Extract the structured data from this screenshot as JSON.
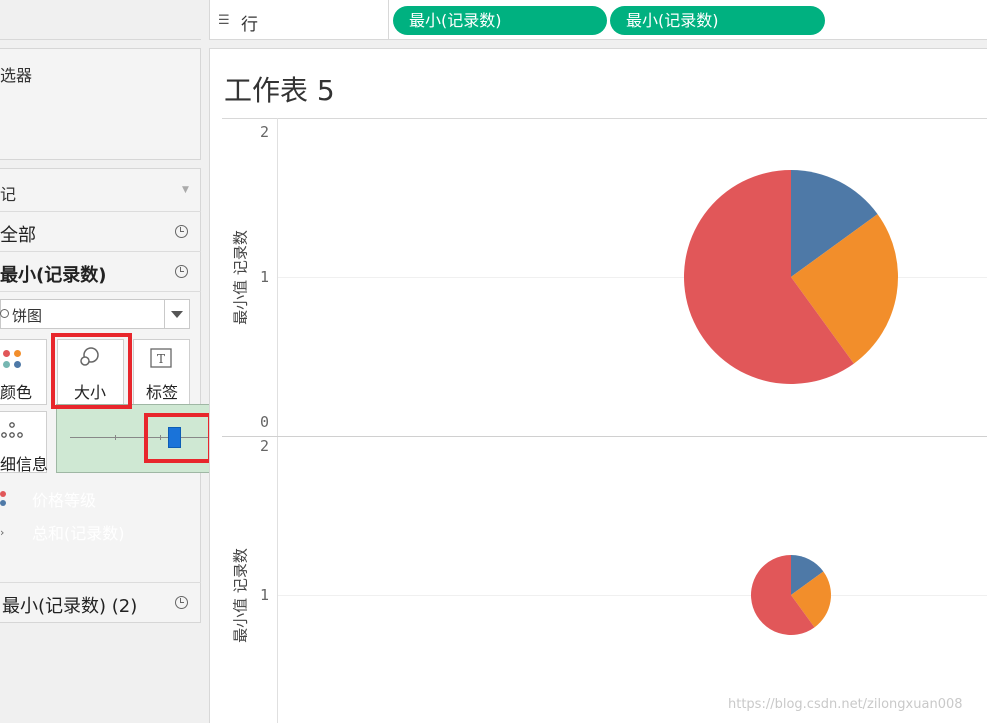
{
  "shelf": {
    "rows_icon": "list-icon",
    "rows_label": "行",
    "pills": [
      "最小(记录数)",
      "最小(记录数)"
    ]
  },
  "filters": {
    "title": "选器"
  },
  "marks": {
    "title": "记",
    "dropdown_icon": "chevron-down-icon",
    "cards": [
      "全部",
      "最小(记录数)",
      "最小(记录数) (2)"
    ],
    "mark_type": "饼图",
    "tiles": {
      "color": "颜色",
      "size": "大小",
      "label": "标签",
      "detail": "细信息"
    },
    "size_slider": {
      "value": 0.6
    },
    "fields": [
      {
        "label": "价格等级",
        "role": "color",
        "color": "#4a96b0"
      },
      {
        "label": "总和(记录数)",
        "role": "angle",
        "color": "#00b180"
      }
    ]
  },
  "view": {
    "sheet_title": "工作表 5",
    "axis_title": "最小值 记录数",
    "ticks_top": [
      "2",
      "1",
      "0"
    ],
    "ticks_bottom": [
      "2",
      "1"
    ]
  },
  "colors": {
    "accent_green": "#00b180",
    "highlight_red": "#e8262c",
    "slice_blue": "#4e79a7",
    "slice_orange": "#f28e2b",
    "slice_red": "#e15759"
  },
  "watermark": "https://blog.csdn.net/zilongxuan008"
}
